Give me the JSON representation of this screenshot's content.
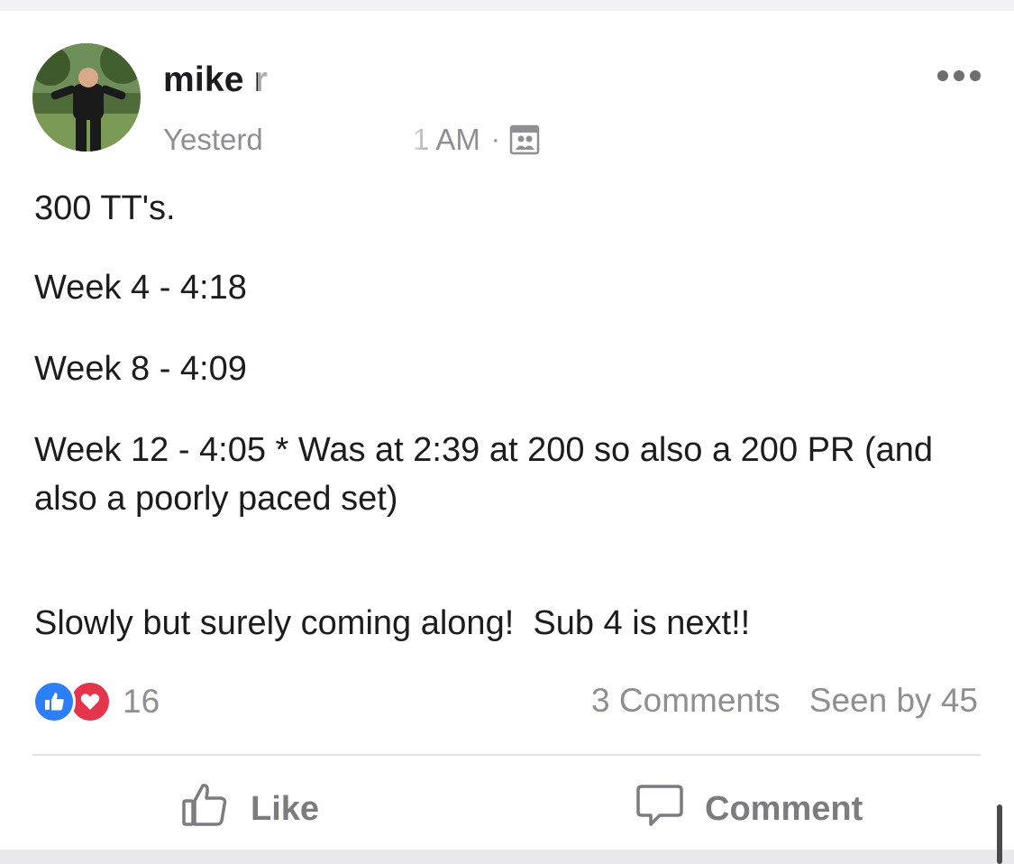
{
  "post": {
    "author": "mike r",
    "meta": {
      "time_prefix": "Yesterd",
      "time_suffix": "1 AM",
      "separator": "·",
      "audience_icon": "group-audience-icon"
    },
    "body": {
      "line1": "300 TT's.",
      "line2": "Week 4 - 4:18",
      "line3": "Week 8 - 4:09",
      "line4": "Week 12 - 4:05 * Was at 2:39 at 200 so also a 200 PR (and also a poorly paced set)",
      "line5": "Slowly but surely coming along!  Sub 4 is next!!"
    },
    "reactions": {
      "icons": [
        "like-icon",
        "love-icon"
      ],
      "count": "16"
    },
    "stats": {
      "comments": "3 Comments",
      "seen_by": "Seen by 45"
    },
    "actions": {
      "like_label": "Like",
      "comment_label": "Comment"
    }
  },
  "colors": {
    "like_blue": "#2d7ff9",
    "love_red": "#e5354d",
    "muted_text": "#8e8e93",
    "body_text": "#1c1c1e"
  }
}
